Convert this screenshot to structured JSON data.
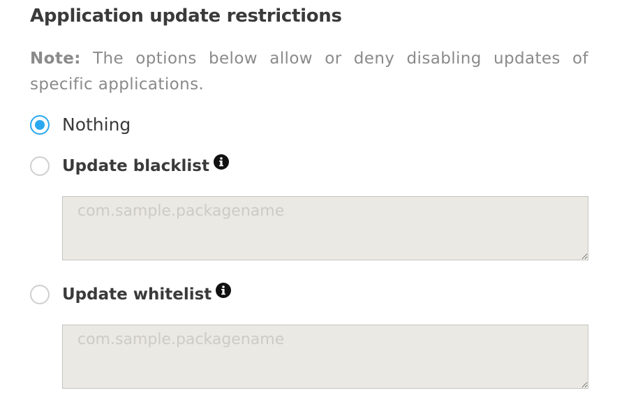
{
  "section": {
    "title": "Application update restrictions",
    "note_label": "Note:",
    "note_text": " The options below allow or deny disabling updates of specific applications."
  },
  "options": [
    {
      "label": "Nothing",
      "checked": true,
      "has_info": false
    },
    {
      "label": "Update blacklist",
      "checked": false,
      "has_info": true,
      "placeholder": "com.sample.packagename"
    },
    {
      "label": "Update whitelist",
      "checked": false,
      "has_info": true,
      "placeholder": "com.sample.packagename"
    }
  ],
  "icons": {
    "info": "info-icon",
    "radio_checked": "radio-checked-icon",
    "radio_unchecked": "radio-unchecked-icon"
  },
  "colors": {
    "accent": "#2aa8f0",
    "text": "#3a3a3a",
    "note": "#8a8a8a",
    "textarea_bg": "#ebe9e3",
    "placeholder": "#cdcbc5"
  }
}
